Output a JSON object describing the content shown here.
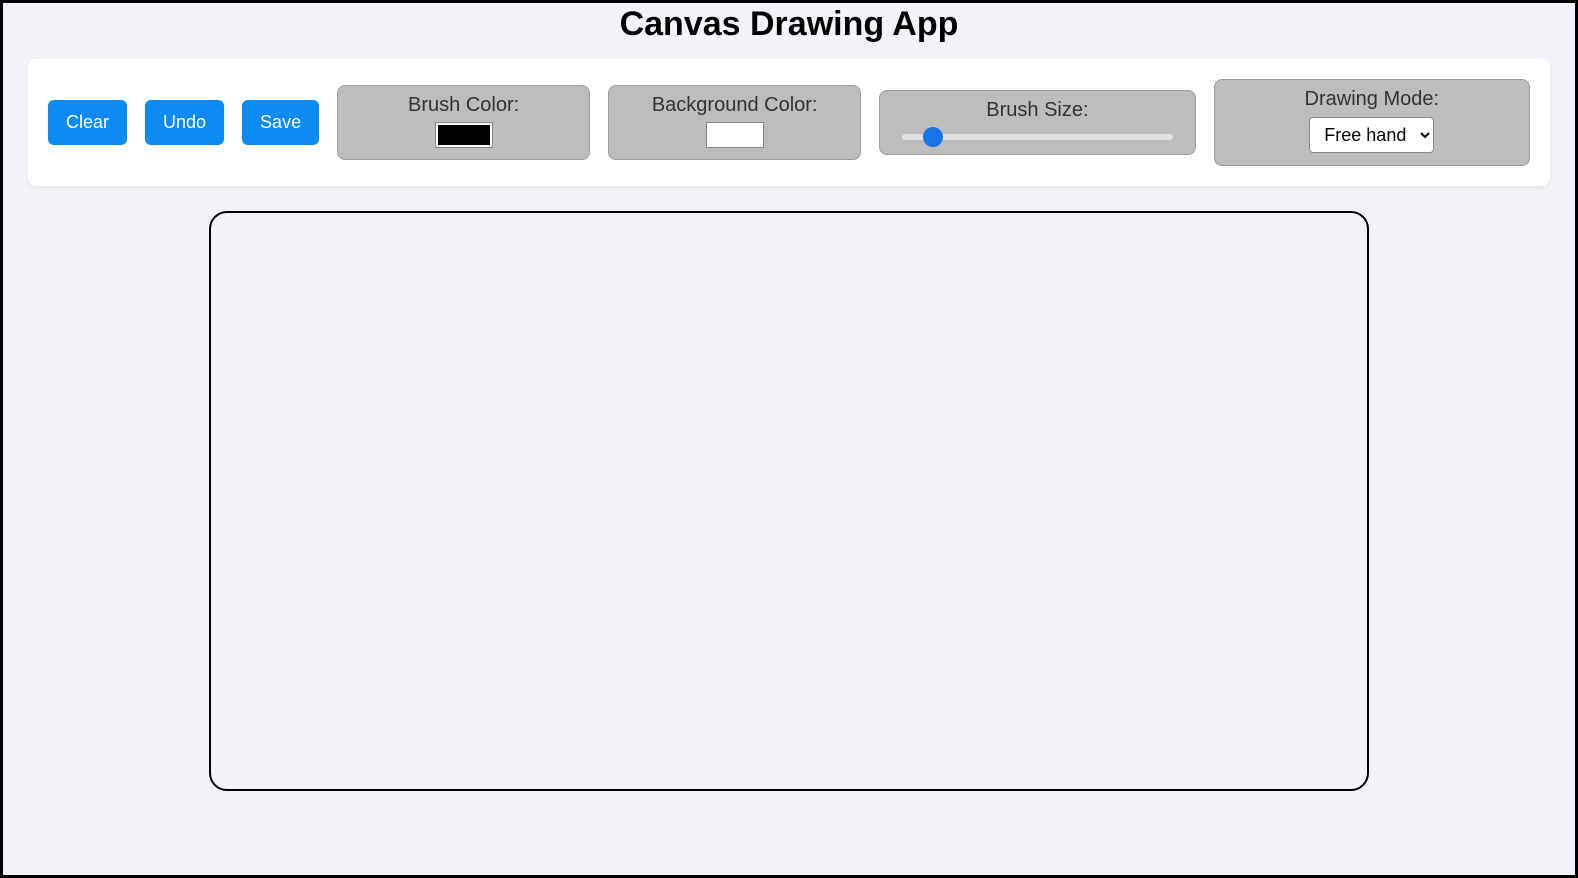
{
  "title": "Canvas Drawing App",
  "toolbar": {
    "clear_label": "Clear",
    "undo_label": "Undo",
    "save_label": "Save",
    "brush_color": {
      "label": "Brush Color:",
      "value": "#000000"
    },
    "background_color": {
      "label": "Background Color:",
      "value": "#ffffff"
    },
    "brush_size": {
      "label": "Brush Size:",
      "min": 1,
      "max": 50,
      "value": 5
    },
    "drawing_mode": {
      "label": "Drawing Mode:",
      "selected": "Free hand",
      "options": [
        "Free hand"
      ]
    }
  }
}
